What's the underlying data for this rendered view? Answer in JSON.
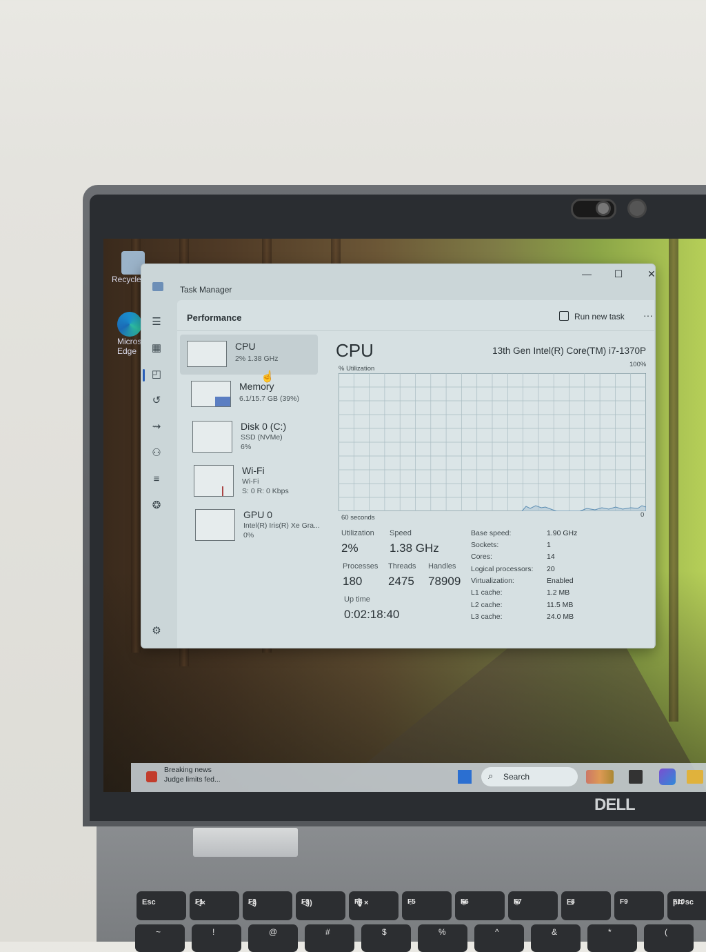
{
  "window": {
    "title": "Task Manager",
    "controls": {
      "minimize": "—",
      "maximize": "☐",
      "close": "✕"
    }
  },
  "desktop": {
    "icons": [
      {
        "label": "Recycle"
      },
      {
        "label": "Micros Edge"
      }
    ]
  },
  "header": {
    "page_title": "Performance",
    "run_new_task": "Run new task",
    "more": "···"
  },
  "sidebar": {
    "items": [
      {
        "name": "CPU",
        "sub1": "2%  1.38 GHz",
        "sub2": ""
      },
      {
        "name": "Memory",
        "sub1": "6.1/15.7 GB (39%)",
        "sub2": ""
      },
      {
        "name": "Disk 0 (C:)",
        "sub1": "SSD (NVMe)",
        "sub2": "6%"
      },
      {
        "name": "Wi-Fi",
        "sub1": "Wi-Fi",
        "sub2": "S: 0  R: 0 Kbps"
      },
      {
        "name": "GPU 0",
        "sub1": "Intel(R) Iris(R) Xe Gra...",
        "sub2": "0%"
      }
    ]
  },
  "cpu_panel": {
    "heading": "CPU",
    "model": "13th Gen Intel(R) Core(TM) i7-1370P",
    "graph_label": "% Utilization",
    "graph_max": "100%",
    "graph_time": "60 seconds",
    "graph_min": "0",
    "utilization_label": "Utilization",
    "utilization": "2%",
    "speed_label": "Speed",
    "speed": "1.38 GHz",
    "processes_label": "Processes",
    "processes": "180",
    "threads_label": "Threads",
    "threads": "2475",
    "handles_label": "Handles",
    "handles": "78909",
    "uptime_label": "Up time",
    "uptime": "0:02:18:40",
    "specs": [
      {
        "label": "Base speed:",
        "value": "1.90 GHz"
      },
      {
        "label": "Sockets:",
        "value": "1"
      },
      {
        "label": "Cores:",
        "value": "14"
      },
      {
        "label": "Logical processors:",
        "value": "20"
      },
      {
        "label": "Virtualization:",
        "value": "Enabled"
      },
      {
        "label": "L1 cache:",
        "value": "1.2 MB"
      },
      {
        "label": "L2 cache:",
        "value": "11.5 MB"
      },
      {
        "label": "L3 cache:",
        "value": "24.0 MB"
      }
    ]
  },
  "taskbar": {
    "news_title": "Breaking news",
    "news_sub": "Judge limits fed...",
    "search": "Search"
  },
  "hardware": {
    "brand": "DELL",
    "keys": [
      {
        "label": "Esc",
        "fn": ""
      },
      {
        "label": "◁×",
        "fn": "F1"
      },
      {
        "label": "◁)",
        "fn": "F2"
      },
      {
        "label": "◁))",
        "fn": "F3"
      },
      {
        "label": "🎙×",
        "fn": "F4"
      },
      {
        "label": "☼",
        "fn": "F5"
      },
      {
        "label": "☀",
        "fn": "F6"
      },
      {
        "label": "☀",
        "fn": "F7"
      },
      {
        "label": "▭",
        "fn": "F8"
      },
      {
        "label": "",
        "fn": "F9"
      },
      {
        "label": "prt sc",
        "fn": "F10"
      }
    ],
    "num_keys": [
      "~",
      "!",
      "@",
      "#",
      "$",
      "%",
      "^",
      "&",
      "*",
      "("
    ]
  }
}
